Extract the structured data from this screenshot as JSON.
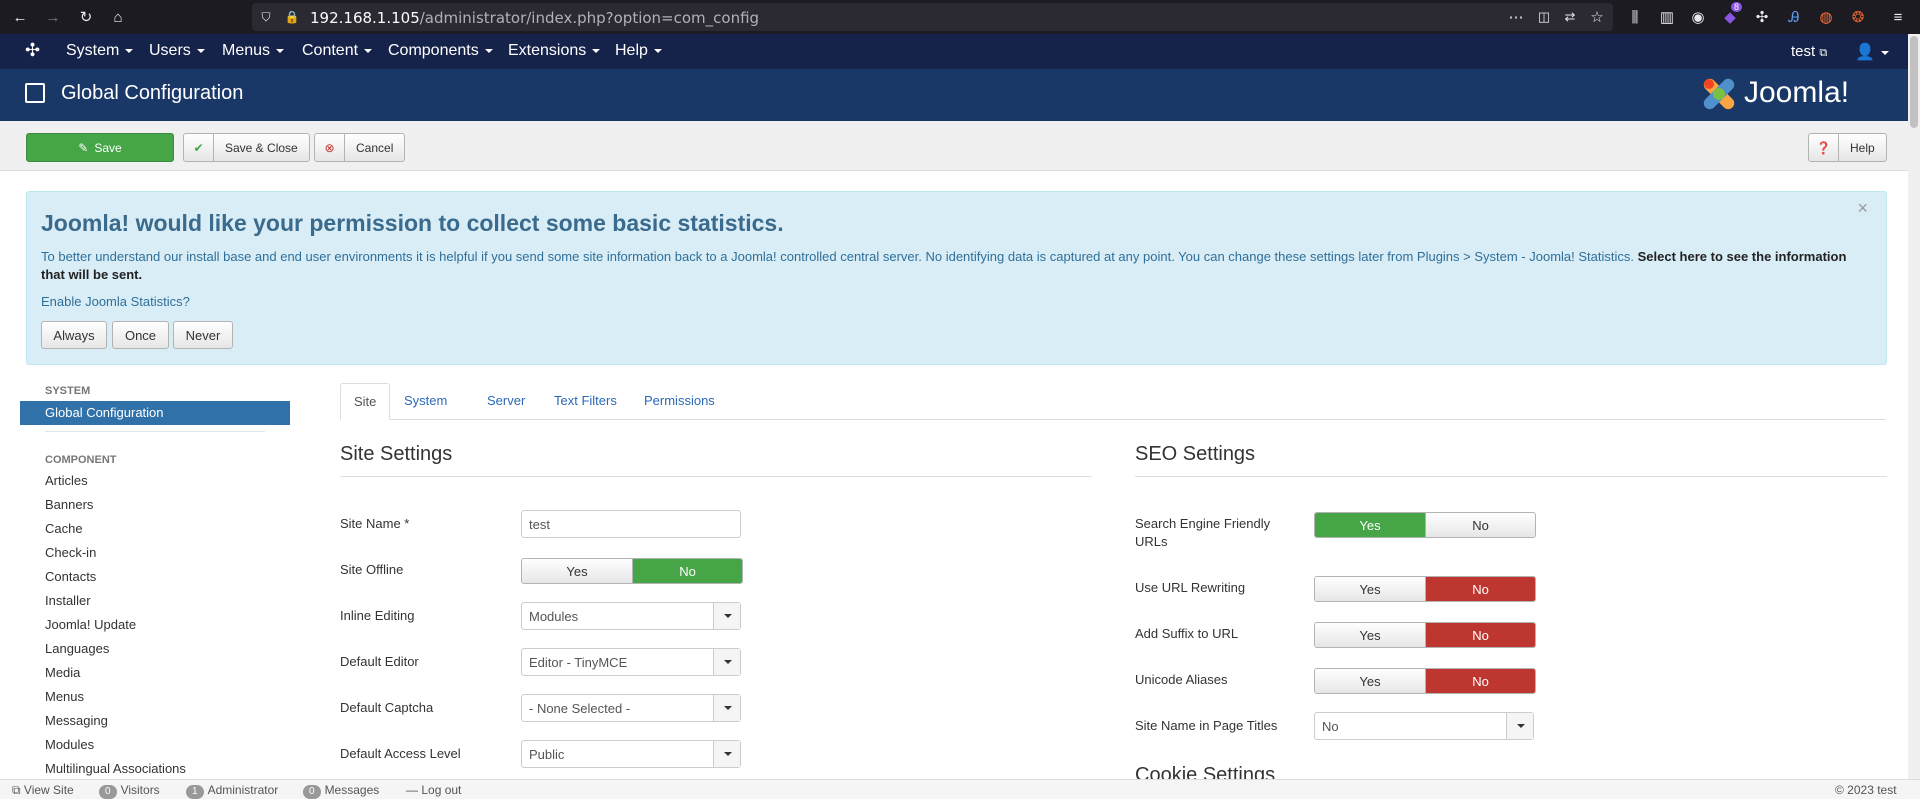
{
  "browser": {
    "url_host": "192.168.1.105",
    "url_path": "/administrator/index.php?option=com_config",
    "ext_badge": "8"
  },
  "nav": {
    "items": [
      "System",
      "Users",
      "Menus",
      "Content",
      "Components",
      "Extensions",
      "Help"
    ],
    "user": "test"
  },
  "header": {
    "title": "Global Configuration",
    "brand": "Joomla!"
  },
  "toolbar": {
    "save": "Save",
    "save_close": "Save & Close",
    "cancel": "Cancel",
    "help": "Help"
  },
  "alert": {
    "title": "Joomla! would like your permission to collect some basic statistics.",
    "text": "To better understand our install base and end user environments it is helpful if you send some site information back to a Joomla! controlled central server. No identifying data is captured at any point. You can change these settings later from Plugins > System - Joomla! Statistics.",
    "link": "Select here to see the information that will be sent.",
    "question": "Enable Joomla Statistics?",
    "always": "Always",
    "once": "Once",
    "never": "Never",
    "close": "×"
  },
  "sidebar": {
    "system_head": "SYSTEM",
    "global": "Global Configuration",
    "component_head": "COMPONENT",
    "items": [
      "Articles",
      "Banners",
      "Cache",
      "Check-in",
      "Contacts",
      "Installer",
      "Joomla! Update",
      "Languages",
      "Media",
      "Menus",
      "Messaging",
      "Modules",
      "Multilingual Associations"
    ]
  },
  "tabs": [
    "Site",
    "System",
    "Server",
    "Text Filters",
    "Permissions"
  ],
  "site": {
    "title": "Site Settings",
    "name_label": "Site Name *",
    "name_value": "test",
    "offline_label": "Site Offline",
    "inline_label": "Inline Editing",
    "inline_value": "Modules",
    "editor_label": "Default Editor",
    "editor_value": "Editor - TinyMCE",
    "captcha_label": "Default Captcha",
    "captcha_value": "- None Selected -",
    "access_label": "Default Access Level",
    "access_value": "Public"
  },
  "seo": {
    "title": "SEO Settings",
    "sef_label": "Search Engine Friendly URLs",
    "rewrite_label": "Use URL Rewriting",
    "suffix_label": "Add Suffix to URL",
    "unicode_label": "Unicode Aliases",
    "pagetitle_label": "Site Name in Page Titles",
    "pagetitle_value": "No",
    "cookie_title": "Cookie Settings"
  },
  "toggle": {
    "yes": "Yes",
    "no": "No"
  },
  "status": {
    "view_site": "View Site",
    "visitors_count": "0",
    "visitors": "Visitors",
    "admin_count": "1",
    "admin": "Administrator",
    "messages_count": "0",
    "messages": "Messages",
    "logout": "Log out",
    "copyright": "© 2023 test"
  },
  "colors": {
    "nav": "#15224a",
    "header": "#1a3867",
    "yes_green": "#46a546",
    "no_red": "#bd362f"
  }
}
